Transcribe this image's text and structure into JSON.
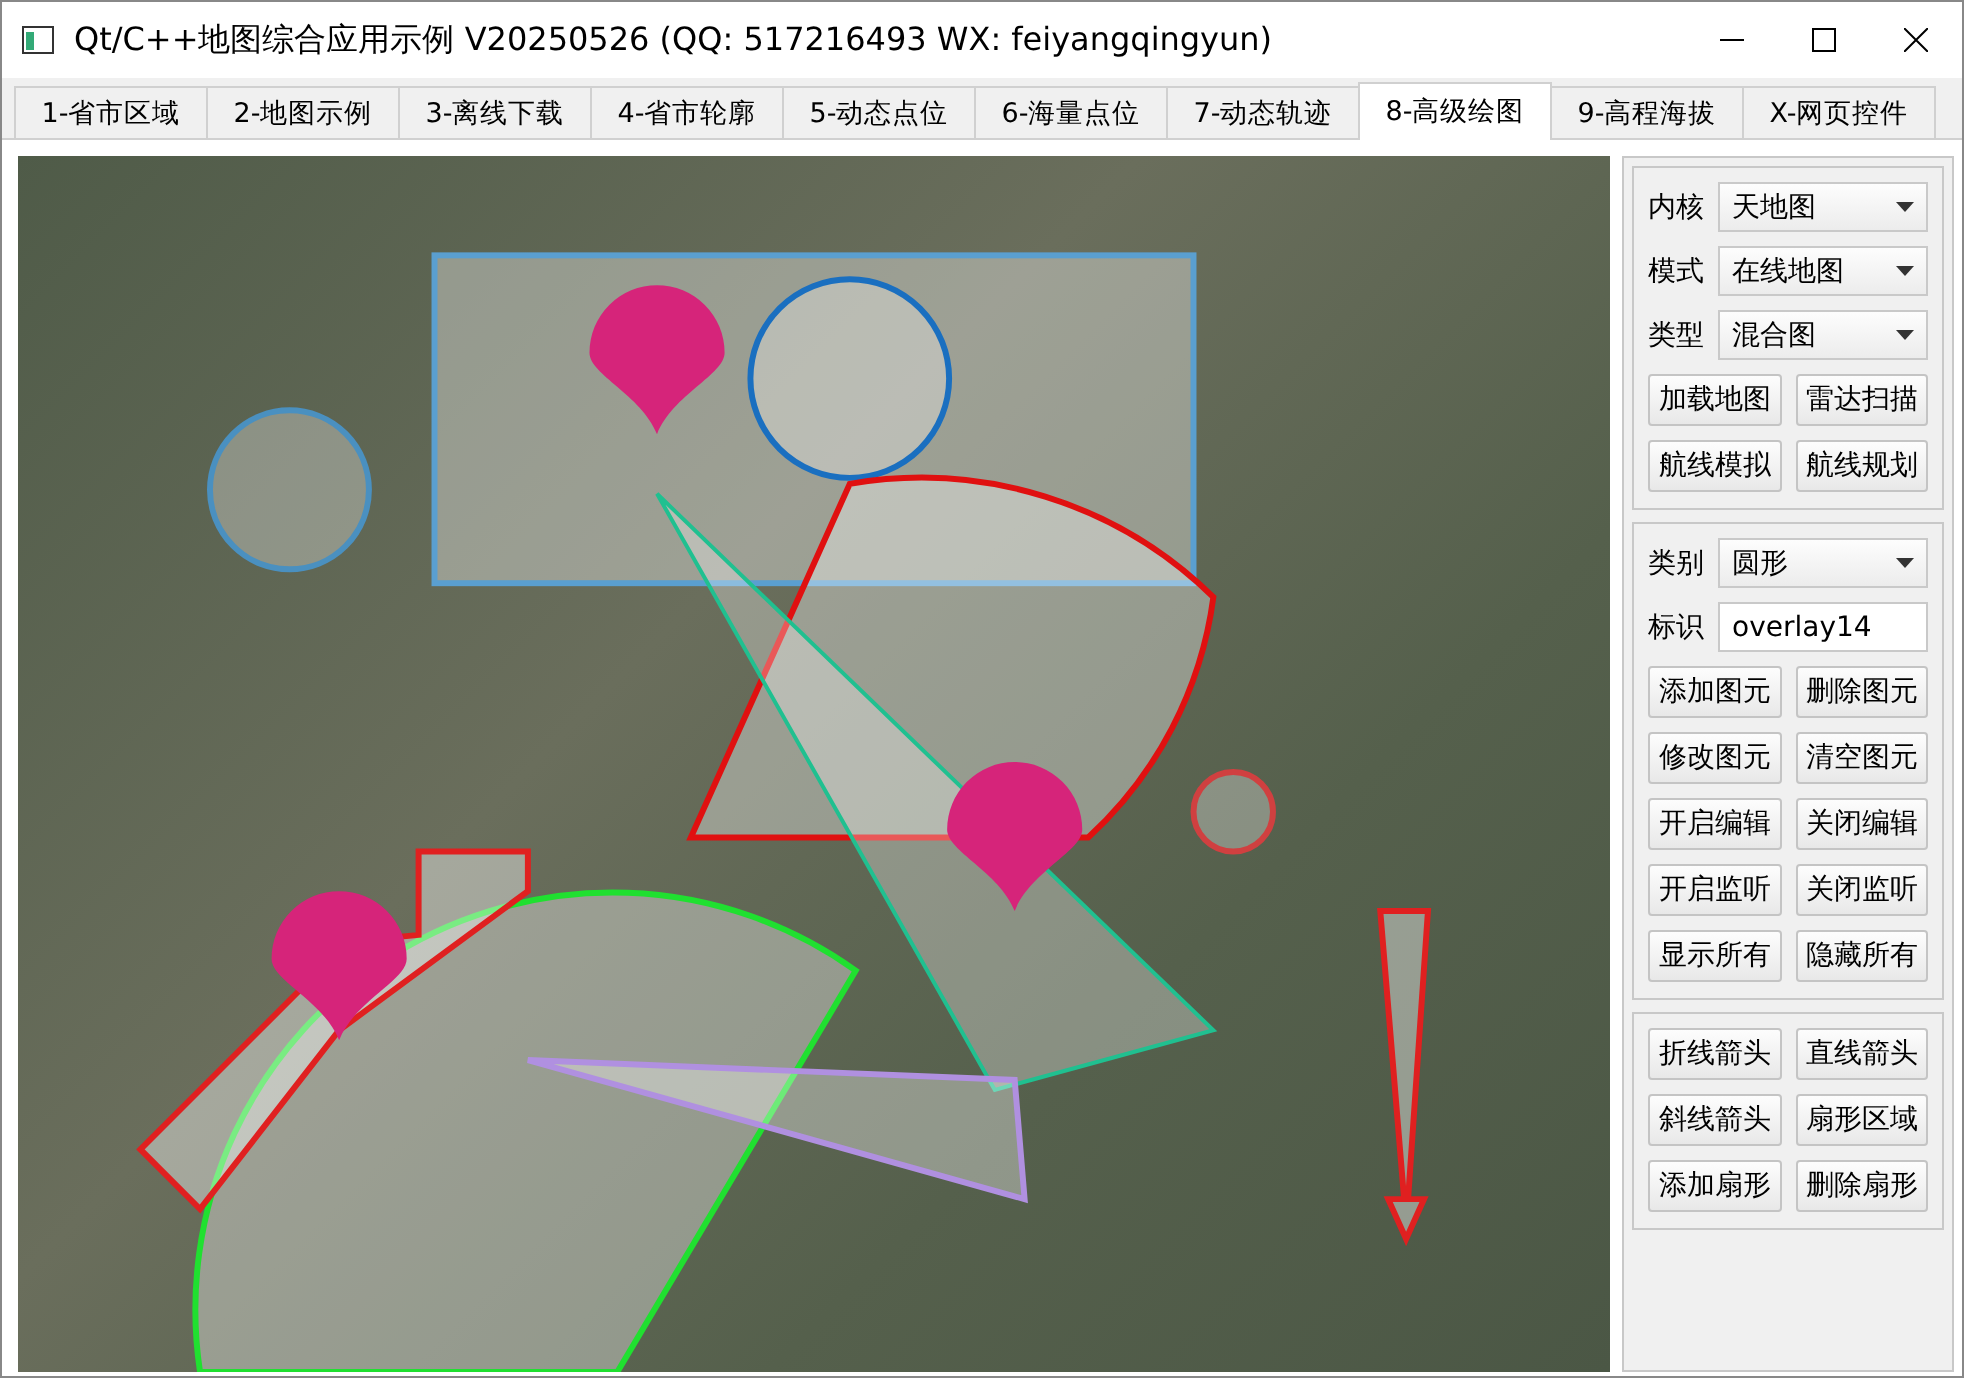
{
  "window": {
    "title": "Qt/C++地图综合应用示例 V20250526 (QQ: 517216493 WX: feiyangqingyun)"
  },
  "tabs": [
    {
      "label": "1-省市区域",
      "selected": false
    },
    {
      "label": "2-地图示例",
      "selected": false
    },
    {
      "label": "3-离线下载",
      "selected": false
    },
    {
      "label": "4-省市轮廓",
      "selected": false
    },
    {
      "label": "5-动态点位",
      "selected": false
    },
    {
      "label": "6-海量点位",
      "selected": false
    },
    {
      "label": "7-动态轨迹",
      "selected": false
    },
    {
      "label": "8-高级绘图",
      "selected": true
    },
    {
      "label": "9-高程海拔",
      "selected": false
    },
    {
      "label": "X-网页控件",
      "selected": false
    }
  ],
  "panel_groups": [
    {
      "rows": [
        {
          "kind": "select",
          "label": "内核",
          "value": "天地图"
        },
        {
          "kind": "select",
          "label": "模式",
          "value": "在线地图"
        },
        {
          "kind": "select",
          "label": "类型",
          "value": "混合图"
        },
        {
          "kind": "buttons",
          "buttons": [
            "加载地图",
            "雷达扫描"
          ]
        },
        {
          "kind": "buttons",
          "buttons": [
            "航线模拟",
            "航线规划"
          ]
        }
      ]
    },
    {
      "rows": [
        {
          "kind": "select",
          "label": "类别",
          "value": "圆形"
        },
        {
          "kind": "input",
          "label": "标识",
          "value": "overlay14"
        },
        {
          "kind": "buttons",
          "buttons": [
            "添加图元",
            "删除图元"
          ]
        },
        {
          "kind": "buttons",
          "buttons": [
            "修改图元",
            "清空图元"
          ]
        },
        {
          "kind": "buttons",
          "buttons": [
            "开启编辑",
            "关闭编辑"
          ]
        },
        {
          "kind": "buttons",
          "buttons": [
            "开启监听",
            "关闭监听"
          ]
        },
        {
          "kind": "buttons",
          "buttons": [
            "显示所有",
            "隐藏所有"
          ]
        }
      ]
    },
    {
      "rows": [
        {
          "kind": "buttons",
          "buttons": [
            "折线箭头",
            "直线箭头"
          ]
        },
        {
          "kind": "buttons",
          "buttons": [
            "斜线箭头",
            "扇形区域"
          ]
        },
        {
          "kind": "buttons",
          "buttons": [
            "添加扇形",
            "删除扇形"
          ]
        }
      ]
    }
  ]
}
